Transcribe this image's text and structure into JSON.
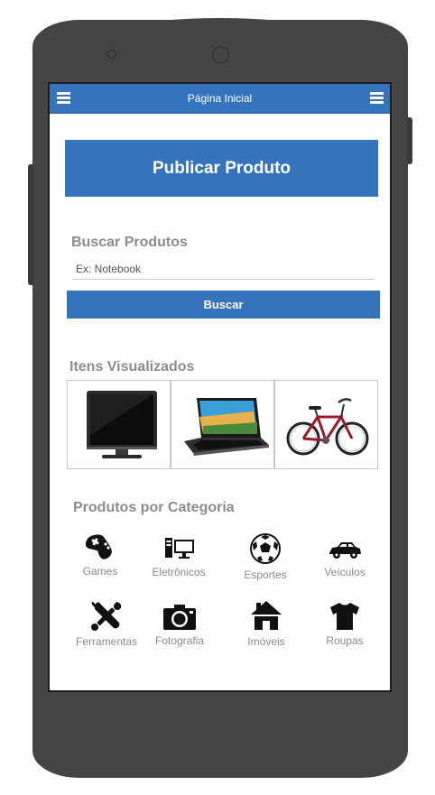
{
  "header": {
    "title": "Página Inicial"
  },
  "publish": {
    "label": "Publicar Produto"
  },
  "search": {
    "title": "Buscar Produtos",
    "placeholder": "Ex: Notebook",
    "button_label": "Buscar"
  },
  "viewed": {
    "title": "Itens Visualizados",
    "items": [
      "tv-image",
      "laptop-image",
      "bicycle-image"
    ]
  },
  "categories": {
    "title": "Produtos por Categoria",
    "items": [
      {
        "label": "Games",
        "icon": "gamepad-icon"
      },
      {
        "label": "Eletrônicos",
        "icon": "computer-icon"
      },
      {
        "label": "Esportes",
        "icon": "soccer-ball-icon"
      },
      {
        "label": "Veículos",
        "icon": "car-icon"
      },
      {
        "label": "Ferramentas",
        "icon": "tools-icon"
      },
      {
        "label": "Fotografia",
        "icon": "camera-icon"
      },
      {
        "label": "Imóveis",
        "icon": "house-icon"
      },
      {
        "label": "Roupas",
        "icon": "shirt-icon"
      }
    ]
  },
  "colors": {
    "accent": "#3673bd",
    "phone": "#454545",
    "muted_text": "#8c8c8c"
  }
}
